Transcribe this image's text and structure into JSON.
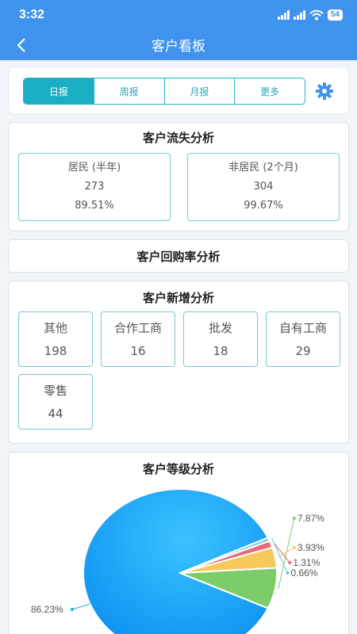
{
  "status_bar": {
    "time": "3:32",
    "battery": "54"
  },
  "nav": {
    "title": "客户看板"
  },
  "tabs": [
    {
      "label": "日报",
      "active": true
    },
    {
      "label": "周报",
      "active": false
    },
    {
      "label": "月报",
      "active": false
    },
    {
      "label": "更多",
      "active": false
    }
  ],
  "customer_loss": {
    "title": "客户流失分析",
    "boxes": [
      {
        "label": "居民 (半年)",
        "count": "273",
        "percent": "89.51%"
      },
      {
        "label": "非居民 (2个月)",
        "count": "304",
        "percent": "99.67%"
      }
    ]
  },
  "repurchase": {
    "title": "客户回购率分析"
  },
  "new_customers": {
    "title": "客户新增分析",
    "items": [
      {
        "label": "其他",
        "value": "198"
      },
      {
        "label": "合作工商",
        "value": "16"
      },
      {
        "label": "批发",
        "value": "18"
      },
      {
        "label": "自有工商",
        "value": "29"
      },
      {
        "label": "零售",
        "value": "44"
      }
    ]
  },
  "chart_data": {
    "type": "pie",
    "title": "客户等级分析",
    "slices": [
      {
        "label": "86.23%",
        "value": 86.23,
        "color": "#1aa6f5"
      },
      {
        "label": "7.87%",
        "value": 7.87,
        "color": "#7ccd6a"
      },
      {
        "label": "3.93%",
        "value": 3.93,
        "color": "#f7c85a"
      },
      {
        "label": "1.31%",
        "value": 1.31,
        "color": "#e86a7a"
      },
      {
        "label": "0.66%",
        "value": 0.66,
        "color": "#6ec7dd"
      }
    ]
  }
}
